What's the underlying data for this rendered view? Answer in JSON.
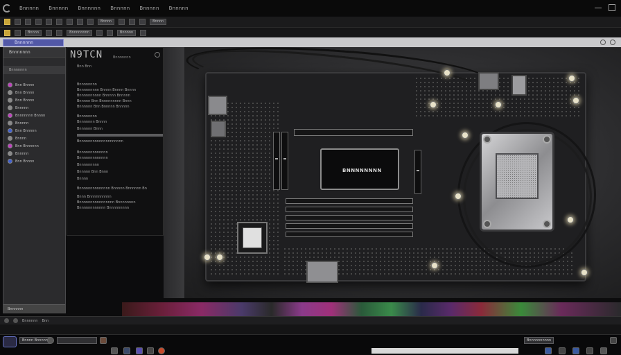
{
  "menu": {
    "items": [
      "Bnnnnn",
      "Bnnnnn",
      "Bnnnnnn",
      "Bnnnnn",
      "Bnnnnn",
      "Bnnnnn"
    ]
  },
  "toolbar1": {
    "buttons": [
      "",
      "",
      "",
      "",
      "",
      "",
      "",
      "",
      "",
      "",
      "Bnnnn",
      "",
      "",
      "",
      "Bnnnn"
    ]
  },
  "toolbar2": {
    "buttons": [
      "",
      "",
      "Bnnnn",
      "",
      "",
      "Bnnnnnnnn",
      "",
      "",
      "Bnnnnn",
      "",
      ""
    ]
  },
  "panel_header": {
    "tab_label": "Bnnnnnn"
  },
  "sidebar": {
    "header": "Bnnnnnnn",
    "subheader": "Bnnnnnnn",
    "items": [
      {
        "label": "Bnn Bnnnn",
        "color": "#c040c0"
      },
      {
        "label": "Bnn Bnnnn",
        "color": "#8a8a8a"
      },
      {
        "label": "Bnn Bnnnn",
        "color": "#8a8a8a"
      },
      {
        "label": "Bnnnnn",
        "color": "#8a8a8a"
      },
      {
        "label": "Bnnnnnnn Bnnnn",
        "color": "#c040c0"
      },
      {
        "label": "Bnnnnn",
        "color": "#8a8a8a"
      },
      {
        "label": "Bnn Bnnnnn",
        "color": "#4060d0"
      },
      {
        "label": "Bnnnn",
        "color": "#8a8a8a"
      },
      {
        "label": "Bnn Bnnnnnn",
        "color": "#c040c0"
      },
      {
        "label": "Bnnnnn",
        "color": "#8a8a8a"
      },
      {
        "label": "Bnn Bnnnn",
        "color": "#4060d0"
      }
    ],
    "footer": "Bnnnnnn"
  },
  "properties": {
    "title": "N9TCN",
    "subtitle": "Bnnnnnnn",
    "header": "Bnn Bnn",
    "lines": [
      "Bnnnnnnnn",
      "Bnnnnnnnnn Bnnnn Bnnnn Bnnnn",
      "Bnnnnnnnnnn Bnnnnn Bnnnnn",
      "Bnnnnn Bnn Bnnnnnnnnn Bnnn",
      "Bnnnnnn Bnn Bnnnnn Bnnnnn",
      "Bnnnnnnnn",
      "Bnnnnnnn Bnnnn",
      "Bnnnnnn Bnnn",
      "Bnnnnnnnnnnnnnnnnnnnn",
      "Bnnnnnnnnnnnnn",
      "Bnnnnnnnnnnnnn",
      "Bnnnnnnnnn",
      "Bnnnnn      Bnn Bnnn",
      "Bnnnn",
      "Bnnnnnnnnnnnnnn Bnnnnn Bnnnnnn Bn",
      "Bnnn Bnnnnnnnnnn",
      "Bnnnnnnnnnnnnnnnn Bnnnnnnnn",
      "Bnnnnnnnnnnnn Bnnnnnnnnn"
    ]
  },
  "board": {
    "chipset_label": "BNNNNNNNN"
  },
  "status": {
    "items": [
      "Bnnnnnn",
      "Bnn"
    ]
  },
  "taskbar": {
    "buttons": [
      "Bnnnn Bnnnnn",
      "",
      "Bnnnnnnnnnn"
    ]
  }
}
